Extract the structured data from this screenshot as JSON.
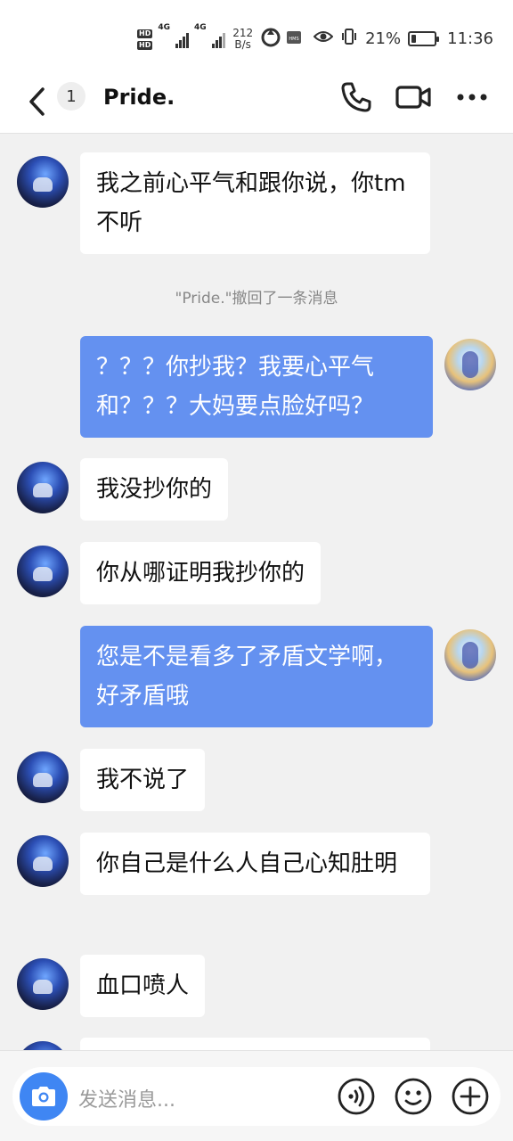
{
  "status": {
    "hd1": "HD",
    "hd2": "HD",
    "net1": "4G",
    "net2": "4G",
    "speed": "212\nB/s",
    "battery_percent": "21%",
    "battery_level": 0.21,
    "time": "11:36"
  },
  "header": {
    "unread_count": "1",
    "title": "Pride."
  },
  "messages": [
    {
      "from": "them",
      "text": "我之前心平气和跟你说，你tm不听"
    },
    {
      "type": "notice",
      "text": "\"Pride.\"撤回了一条消息"
    },
    {
      "from": "me",
      "text": "？？？你抄我？我要心平气和？？？大妈要点脸好吗？"
    },
    {
      "from": "them",
      "text": "我没抄你的"
    },
    {
      "from": "them",
      "text": "你从哪证明我抄你的"
    },
    {
      "from": "me",
      "text": "您是不是看多了矛盾文学啊，好矛盾哦"
    },
    {
      "from": "them",
      "text": "我不说了"
    },
    {
      "from": "them",
      "text": "你自己是什么人自己心知肚明"
    },
    {
      "from": "them",
      "text": "血口喷人"
    }
  ],
  "input": {
    "placeholder": "发送消息..."
  },
  "icons": {
    "back": "chevron-left-icon",
    "call": "phone-icon",
    "video": "video-camera-icon",
    "more": "more-dots-icon",
    "camera": "camera-icon",
    "voice": "voice-icon",
    "emoji": "emoji-icon",
    "plus": "plus-icon"
  },
  "colors": {
    "my_bubble": "#6491f0",
    "their_bubble": "#ffffff",
    "camera_button": "#3f86f3",
    "background": "#f1f1f1"
  }
}
